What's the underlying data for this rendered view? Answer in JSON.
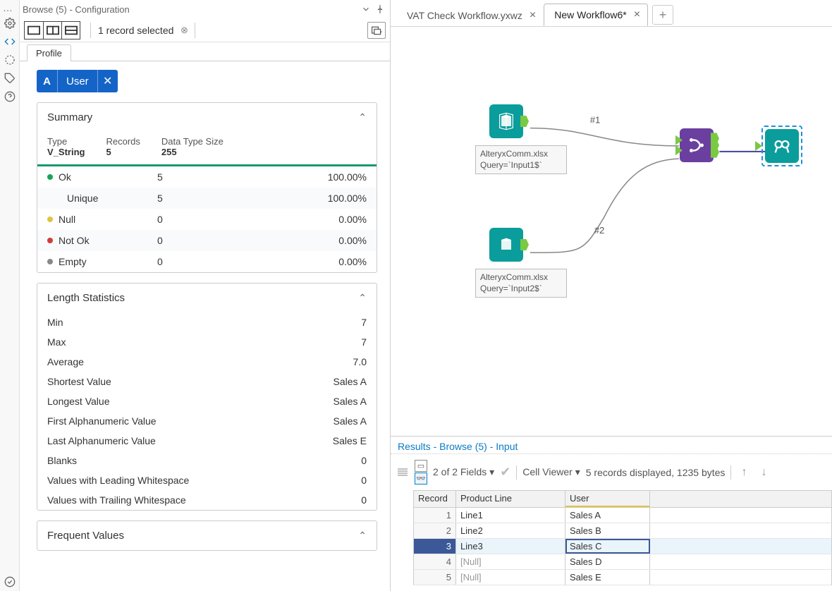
{
  "panel_title": "Browse (5) - Configuration",
  "toolbar": {
    "record_selected": "1 record selected"
  },
  "profile_tab": "Profile",
  "field_chip": {
    "type_letter": "A",
    "name": "User"
  },
  "summary": {
    "title": "Summary",
    "headers": {
      "type": "Type",
      "records": "Records",
      "size": "Data Type Size"
    },
    "values": {
      "type": "V_String",
      "records": "5",
      "size": "255"
    },
    "rows": [
      {
        "dot": "#18a558",
        "label": "Ok",
        "count": "5",
        "pct": "100.00%",
        "indent": false
      },
      {
        "dot": "",
        "label": "Unique",
        "count": "5",
        "pct": "100.00%",
        "indent": true
      },
      {
        "dot": "#e0c341",
        "label": "Null",
        "count": "0",
        "pct": "0.00%",
        "indent": false
      },
      {
        "dot": "#d33c3c",
        "label": "Not Ok",
        "count": "0",
        "pct": "0.00%",
        "indent": false
      },
      {
        "dot": "#888888",
        "label": "Empty",
        "count": "0",
        "pct": "0.00%",
        "indent": false
      }
    ]
  },
  "length_stats": {
    "title": "Length Statistics",
    "rows": [
      {
        "label": "Min",
        "val": "7"
      },
      {
        "label": "Max",
        "val": "7"
      },
      {
        "label": "Average",
        "val": "7.0"
      },
      {
        "label": "Shortest Value",
        "val": "Sales A"
      },
      {
        "label": "Longest Value",
        "val": "Sales A"
      },
      {
        "label": "First Alphanumeric Value",
        "val": "Sales A"
      },
      {
        "label": "Last Alphanumeric Value",
        "val": "Sales E"
      },
      {
        "label": "Blanks",
        "val": "0"
      },
      {
        "label": "Values with Leading Whitespace",
        "val": "0"
      },
      {
        "label": "Values with Trailing Whitespace",
        "val": "0"
      }
    ]
  },
  "frequent_values": {
    "title": "Frequent Values"
  },
  "tabs": [
    {
      "label": "VAT Check Workflow.yxwz",
      "active": false
    },
    {
      "label": "New Workflow6*",
      "active": true
    }
  ],
  "canvas": {
    "input1_label": "AlteryxComm.xlsx\nQuery=`Input1$`",
    "input2_label": "AlteryxComm.xlsx\nQuery=`Input2$`",
    "edge1": "#1",
    "edge2": "#2"
  },
  "results": {
    "title": "Results - Browse (5) - Input",
    "fields_text": "2 of 2 Fields",
    "cell_viewer": "Cell Viewer",
    "status": "5 records displayed, 1235 bytes",
    "columns": {
      "record": "Record",
      "product_line": "Product Line",
      "user": "User"
    },
    "rows": [
      {
        "rec": "1",
        "pl": "Line1",
        "u": "Sales A",
        "null_pl": false,
        "selected": false
      },
      {
        "rec": "2",
        "pl": "Line2",
        "u": "Sales B",
        "null_pl": false,
        "selected": false
      },
      {
        "rec": "3",
        "pl": "Line3",
        "u": "Sales C",
        "null_pl": false,
        "selected": true
      },
      {
        "rec": "4",
        "pl": "[Null]",
        "u": "Sales D",
        "null_pl": true,
        "selected": false
      },
      {
        "rec": "5",
        "pl": "[Null]",
        "u": "Sales E",
        "null_pl": true,
        "selected": false
      }
    ]
  }
}
